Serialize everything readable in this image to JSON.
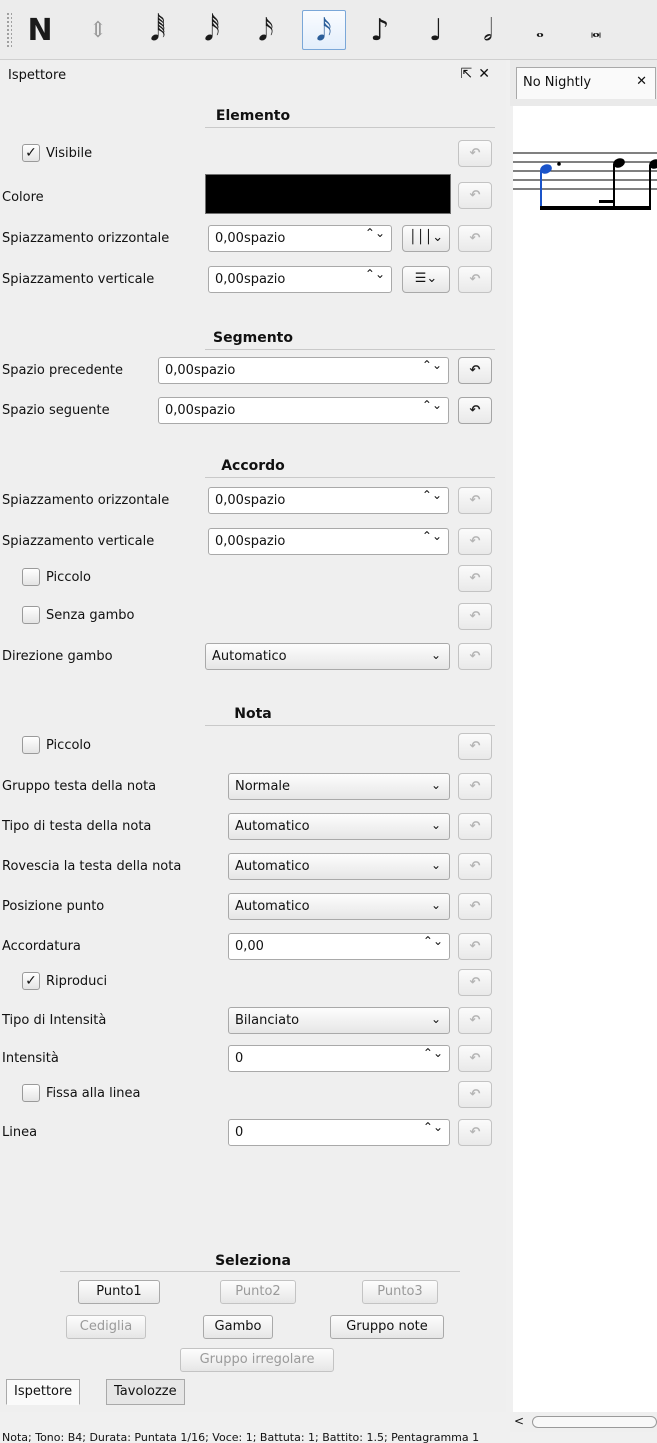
{
  "toolbar": {
    "buttons": [
      {
        "glyph": "N",
        "name": "note-input-icon"
      },
      {
        "glyph": "⇕",
        "name": "voice-toggle-icon"
      },
      {
        "glyph": "𝅘𝅥𝅱",
        "name": "128th-note-icon"
      },
      {
        "glyph": "𝅘𝅥𝅰",
        "name": "64th-note-icon"
      },
      {
        "glyph": "𝅘𝅥𝅯",
        "name": "32nd-note-icon"
      },
      {
        "glyph": "𝅘𝅥𝅯",
        "name": "16th-note-icon"
      },
      {
        "glyph": "♪",
        "name": "eighth-note-icon"
      },
      {
        "glyph": "♩",
        "name": "quarter-note-icon"
      },
      {
        "glyph": "𝅗𝅥",
        "name": "half-note-icon"
      },
      {
        "glyph": "𝅝",
        "name": "whole-note-icon"
      },
      {
        "glyph": "𝅜",
        "name": "breve-note-icon"
      }
    ],
    "active_index": 5
  },
  "panel": {
    "title": "Ispettore",
    "float_icon": "⇱",
    "close_icon": "✕"
  },
  "reset_glyph": "↶",
  "spin_glyph": "⌃⌄",
  "combo_arrow": "⌄",
  "check_mark": "✓",
  "elemento": {
    "title": "Elemento",
    "visible_label": "Visibile",
    "visible_checked": true,
    "color_label": "Colore",
    "color_value": "#000000",
    "hoffset_label": "Spiazzamento orizzontale",
    "hoffset_value": "0,00spazio",
    "voffset_label": "Spiazzamento verticale",
    "voffset_value": "0,00spazio"
  },
  "segmento": {
    "title": "Segmento",
    "leading_label": "Spazio precedente",
    "leading_value": "0,00spazio",
    "trailing_label": "Spazio seguente",
    "trailing_value": "0,00spazio"
  },
  "accordo": {
    "title": "Accordo",
    "hoffset_label": "Spiazzamento orizzontale",
    "hoffset_value": "0,00spazio",
    "voffset_label": "Spiazzamento verticale",
    "voffset_value": "0,00spazio",
    "small_label": "Piccolo",
    "small_checked": false,
    "stemless_label": "Senza gambo",
    "stemless_checked": false,
    "stem_dir_label": "Direzione gambo",
    "stem_dir_value": "Automatico"
  },
  "nota": {
    "title": "Nota",
    "small_label": "Piccolo",
    "small_checked": false,
    "head_group_label": "Gruppo testa della nota",
    "head_group_value": "Normale",
    "head_type_label": "Tipo di testa della nota",
    "head_type_value": "Automatico",
    "mirror_label": "Rovescia la testa della nota",
    "mirror_value": "Automatico",
    "dot_pos_label": "Posizione punto",
    "dot_pos_value": "Automatico",
    "tuning_label": "Accordatura",
    "tuning_value": "0,00",
    "play_label": "Riproduci",
    "play_checked": true,
    "velo_type_label": "Tipo di Intensità",
    "velo_type_value": "Bilanciato",
    "velo_label": "Intensità",
    "velo_value": "0",
    "fix_label": "Fissa alla linea",
    "fix_checked": false,
    "line_label": "Linea",
    "line_value": "0"
  },
  "seleziona": {
    "title": "Seleziona",
    "dot1": "Punto1",
    "dot2": "Punto2",
    "dot3": "Punto3",
    "hook": "Cediglia",
    "stem": "Gambo",
    "beam": "Gruppo note",
    "tuplet": "Gruppo irregolare"
  },
  "bottom_tabs": [
    "Ispettore",
    "Tavolozze"
  ],
  "score_tab": {
    "label": "No Nightly",
    "close": "✕"
  },
  "scroll_left": "<",
  "status": "Nota; Tono: B4; Durata: Puntata 1/16; Voce: 1;  Battuta: 1; Battito: 1.5; Pentagramma 1"
}
